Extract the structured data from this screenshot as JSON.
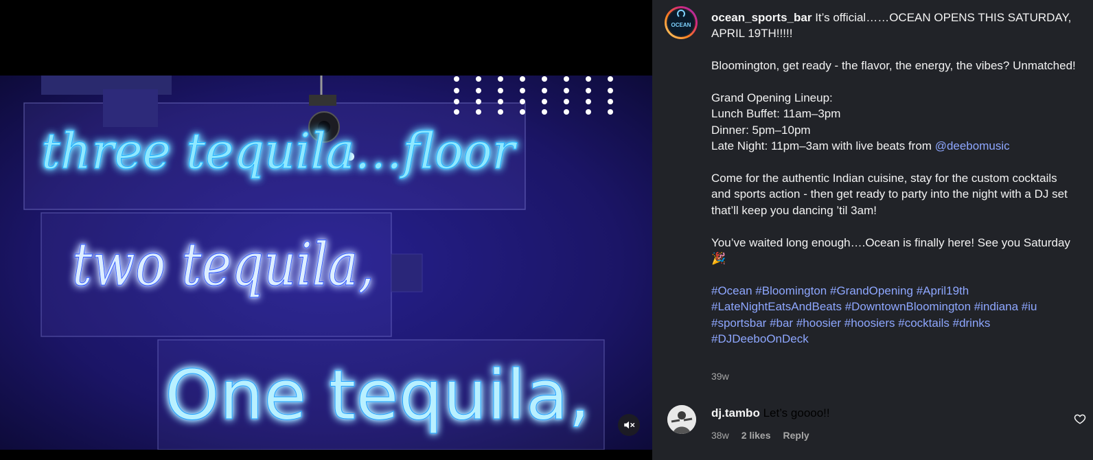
{
  "post": {
    "username": "ocean_sports_bar",
    "avatar_text": "OCEAN",
    "caption_intro": "It’s official……OCEAN OPENS THIS SATURDAY, APRIL 19TH!!!!!",
    "p1": "Bloomington, get ready - the flavor, the energy, the vibes? Unmatched!",
    "lineup_title": "Grand Opening Lineup:",
    "line1": "Lunch Buffet: 11am–3pm",
    "line2": "Dinner: 5pm–10pm",
    "line3": "Late Night: 11pm–3am with live beats from ",
    "mention": "@deebomusic",
    "p3": "Come for the authentic Indian cuisine, stay for the custom cocktails and sports action - then get ready to party into the night with a DJ set that’ll keep you dancing ’til 3am!",
    "p4": "You’ve waited long enough….Ocean is finally here! See you Saturday 🎉",
    "hashtags": [
      "#Ocean",
      "#Bloomington",
      "#GrandOpening",
      "#April19th",
      "#LateNightEatsAndBeats",
      "#DowntownBloomington",
      "#indiana",
      "#iu",
      "#sportsbar",
      "#bar",
      "#hoosier",
      "#hoosiers",
      "#cocktails",
      "#drinks",
      "#DJDeeboOnDeck"
    ],
    "age": "39w"
  },
  "media": {
    "sign_line1": "three tequila…floor",
    "sign_line2": "two tequila,",
    "sign_line3": "One tequila,",
    "mute_icon": "speaker-muted-icon"
  },
  "comment": {
    "username": "dj.tambo",
    "text": "Let’s goooo!!",
    "age": "38w",
    "likes": "2 likes",
    "reply": "Reply"
  },
  "colors": {
    "panel_bg": "#212328",
    "link": "#8ea7ff",
    "neon": "#4fc8ff",
    "neon_glow": "#1a3cff"
  }
}
